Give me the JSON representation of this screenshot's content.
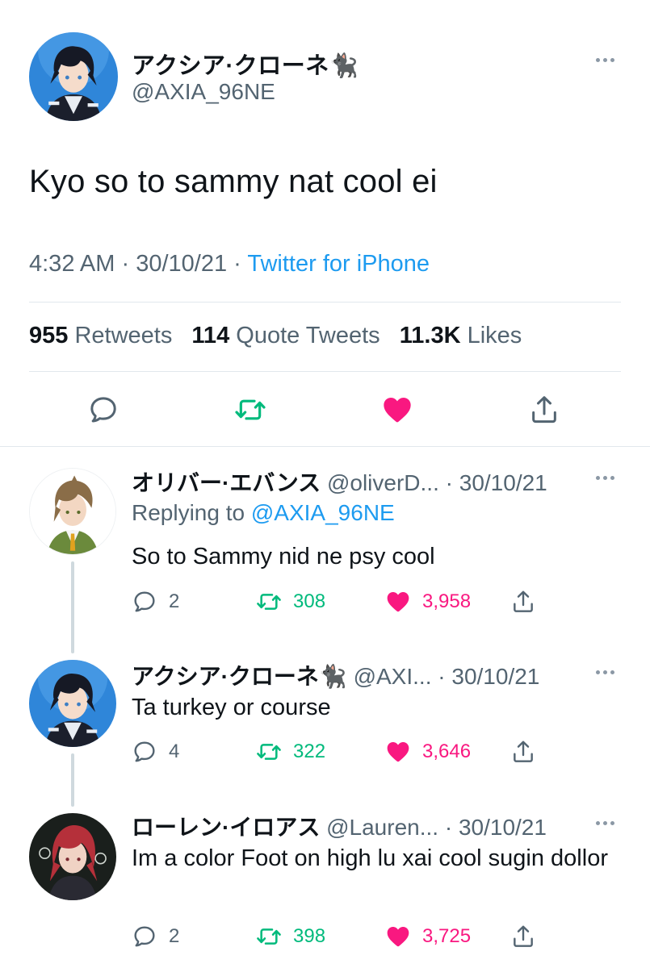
{
  "tweet": {
    "display_name": "アクシア·クローネ🐈‍⬛",
    "handle": "@AXIA_96NE",
    "text": "Kyo so to sammy nat cool ei",
    "time": "4:32 AM",
    "date": "30/10/21",
    "source": "Twitter for iPhone",
    "retweets_count": "955",
    "retweets_label": "Retweets",
    "quotes_count": "114",
    "quotes_label": "Quote Tweets",
    "likes_count": "11.3K",
    "likes_label": "Likes"
  },
  "replies": [
    {
      "display_name": "オリバー·エバンス",
      "handle": "@oliverD...",
      "date": "30/10/21",
      "replying_prefix": "Replying to",
      "replying_to": "@AXIA_96NE",
      "text": "So to Sammy nid ne psy cool",
      "reply_count": "2",
      "retweet_count": "308",
      "like_count": "3,958"
    },
    {
      "display_name": "アクシア·クローネ🐈‍⬛",
      "handle": "@AXI...",
      "date": "30/10/21",
      "text": "Ta turkey or course",
      "reply_count": "4",
      "retweet_count": "322",
      "like_count": "3,646"
    },
    {
      "display_name": "ローレン·イロアス",
      "handle": "@Lauren...",
      "date": "30/10/21",
      "text": "Im a color Foot on high lu xai cool sugin dollor",
      "reply_count": "2",
      "retweet_count": "398",
      "like_count": "3,725"
    }
  ],
  "separator": "·",
  "colors": {
    "accent_blue": "#1d9bf0",
    "retweet_green": "#00ba7c",
    "like_pink": "#f91880",
    "secondary_text": "#536471"
  },
  "icons": [
    "reply-icon",
    "retweet-icon",
    "like-icon",
    "share-icon",
    "more-icon"
  ]
}
